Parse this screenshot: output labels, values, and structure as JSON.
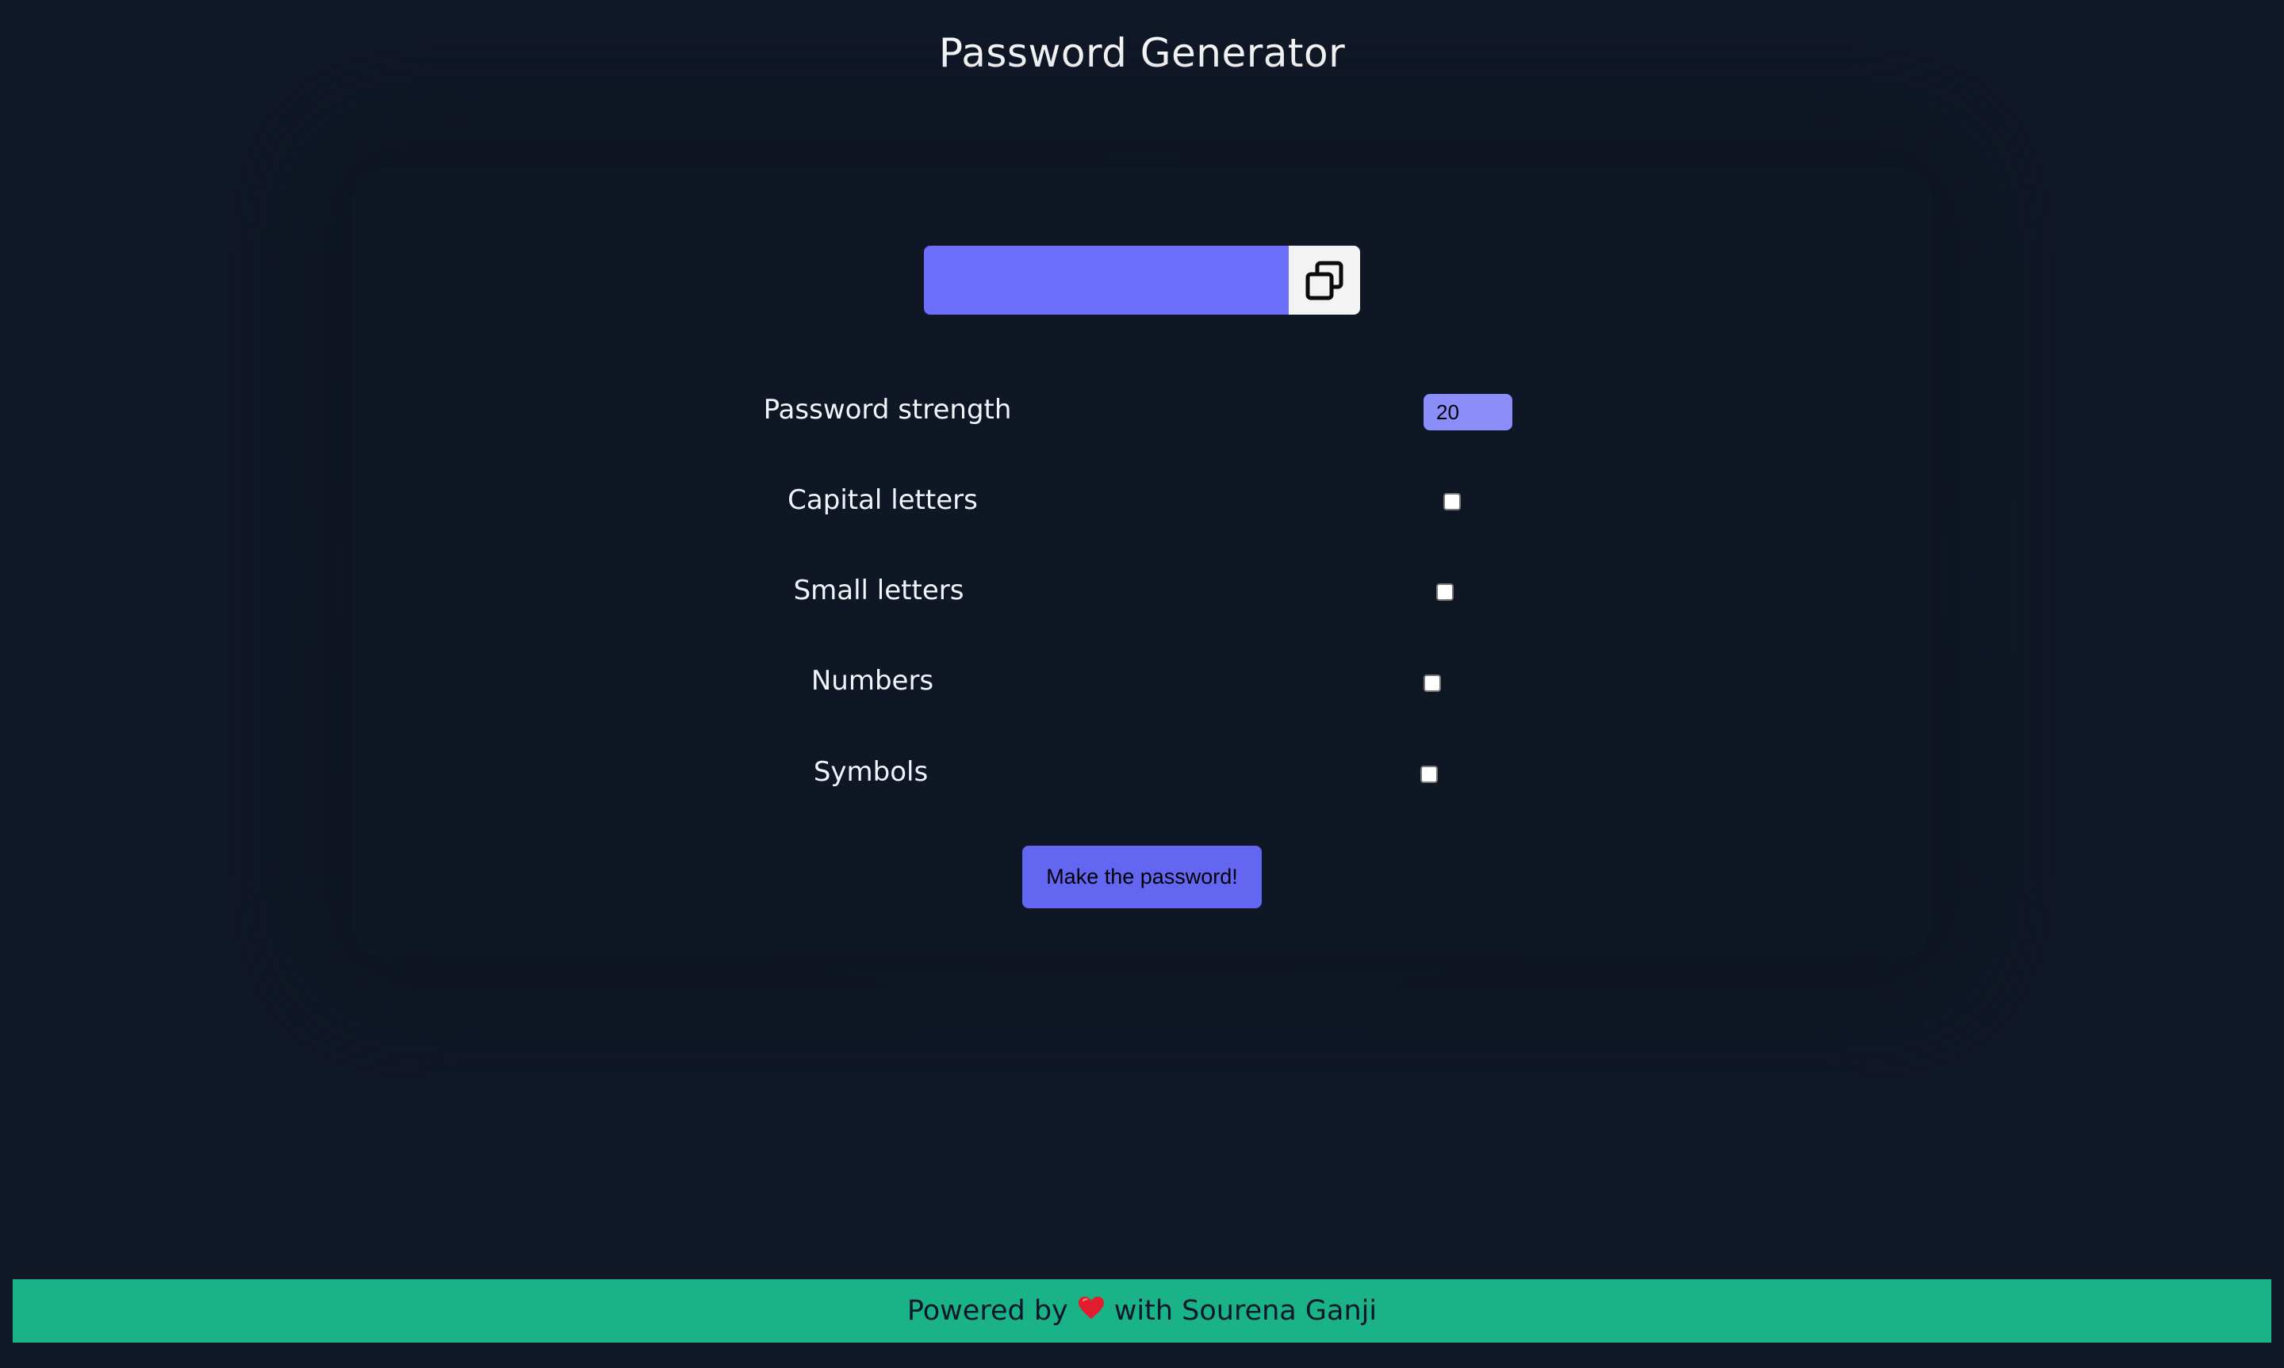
{
  "header": {
    "title": "Password Generator"
  },
  "output": {
    "value": "",
    "copy_icon": "copy-icon"
  },
  "options": {
    "length_label": "Password strength",
    "length_value": "20",
    "capital_label": "Capital letters",
    "capital_checked": false,
    "small_label": "Small letters",
    "small_checked": false,
    "numbers_label": "Numbers",
    "numbers_checked": false,
    "symbols_label": "Symbols",
    "symbols_checked": false
  },
  "actions": {
    "generate_label": "Make the password!"
  },
  "footer": {
    "prefix": "Powered by",
    "heart_icon": "heart-icon",
    "suffix": "with Sourena Ganji"
  },
  "colors": {
    "background": "#111827",
    "card": "#0f1725",
    "accent": "#6366f1",
    "footer": "#19b387"
  }
}
